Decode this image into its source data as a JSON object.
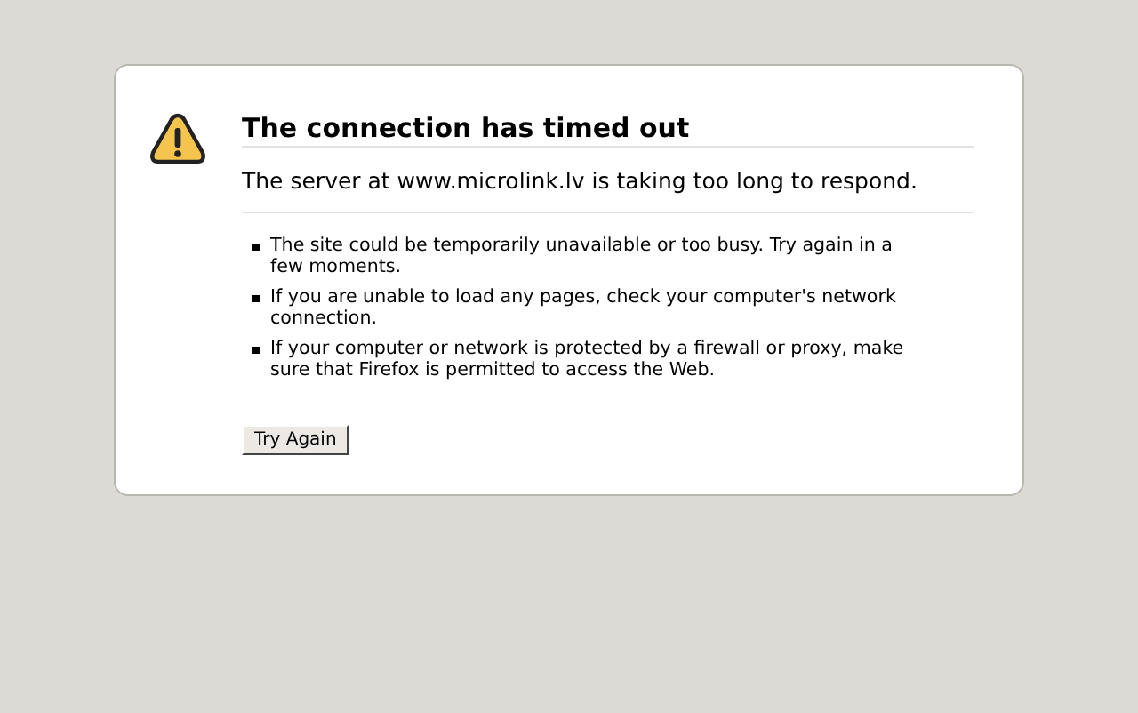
{
  "title": "The connection has timed out",
  "message": "The server at www.microlink.lv is taking too long to respond.",
  "suggestions": [
    "The site could be temporarily unavailable or too busy. Try again in a few moments.",
    "If you are unable to load any pages, check your computer's network connection.",
    "If your computer or network is protected by a firewall or proxy, make sure that Firefox is permitted to access the Web."
  ],
  "button": "Try Again"
}
